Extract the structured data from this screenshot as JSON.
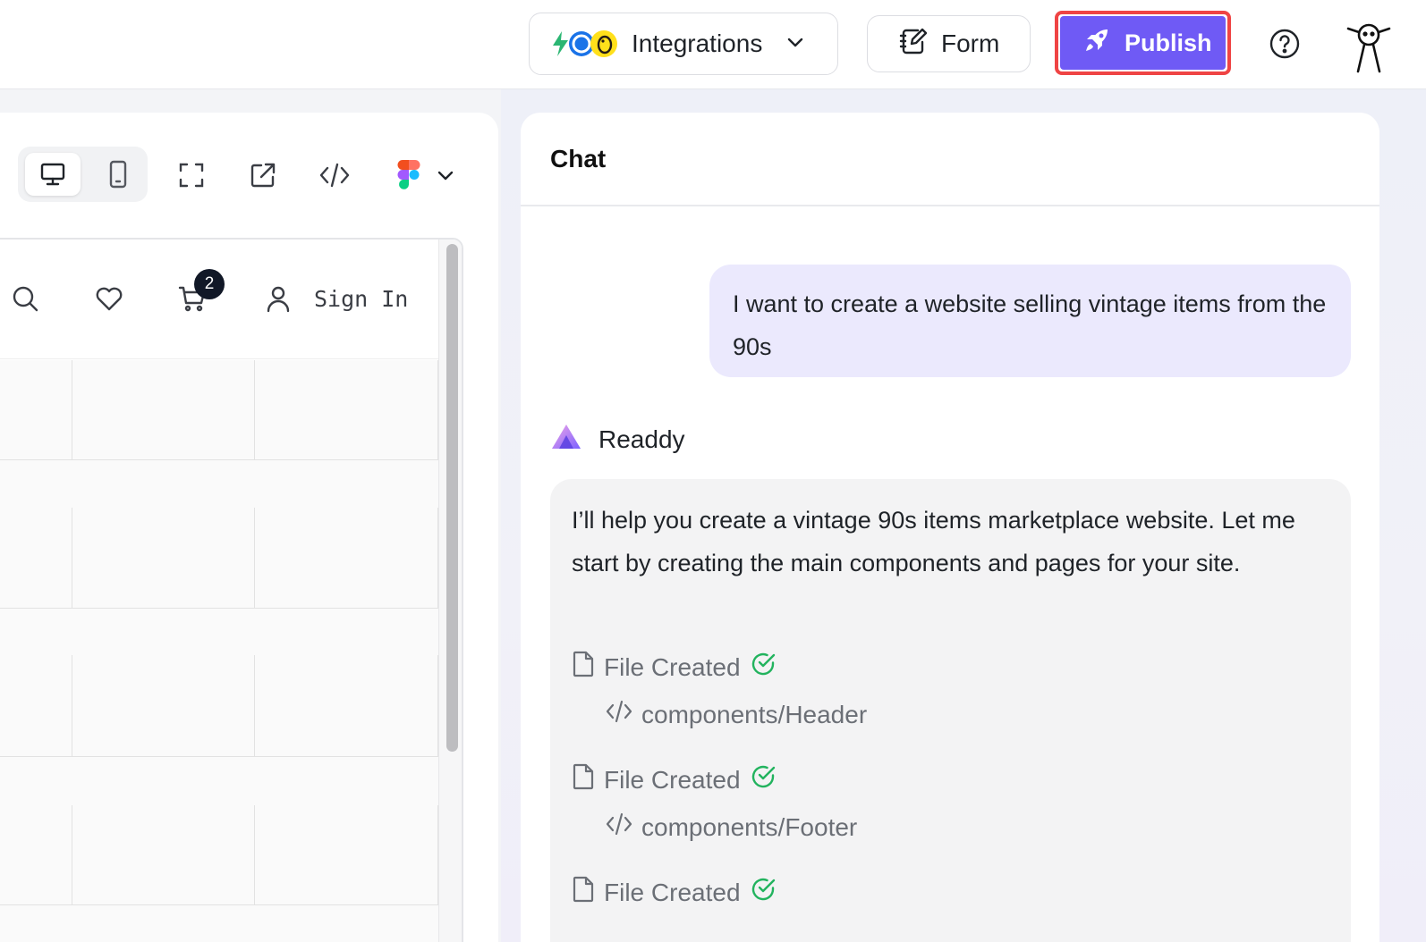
{
  "topbar": {
    "integrations_label": "Integrations",
    "form_label": "Form",
    "publish_label": "Publish",
    "accent_color": "#6f5af5",
    "highlight_color": "#ef4444"
  },
  "preview": {
    "cart_count": "2",
    "signin_label": "Sign In"
  },
  "chat": {
    "title": "Chat",
    "user_message": "I want to create a website selling vintage items from the 90s",
    "bot_name": "Readdy",
    "bot_message": "I’ll help you create a vintage 90s items marketplace website. Let me start by creating the main components and pages for your site.",
    "files": [
      {
        "status": "File Created",
        "path": "components/Header"
      },
      {
        "status": "File Created",
        "path": "components/Footer"
      },
      {
        "status": "File Created",
        "path": ""
      }
    ]
  }
}
